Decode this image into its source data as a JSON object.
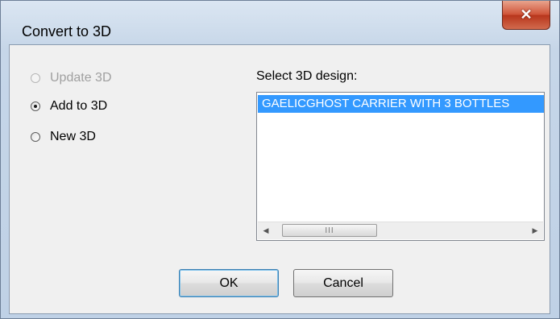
{
  "window": {
    "title": "Convert to 3D",
    "close_glyph": "✕"
  },
  "options": {
    "update": {
      "label": "Update 3D",
      "enabled": false,
      "selected": false
    },
    "add": {
      "label": "Add to 3D",
      "enabled": true,
      "selected": true
    },
    "new": {
      "label": "New 3D",
      "enabled": true,
      "selected": false
    }
  },
  "design_list": {
    "label": "Select 3D design:",
    "items": [
      "GAELICGHOST CARRIER WITH 3 BOTTLES"
    ],
    "selected_index": 0,
    "scroll_grip": "III",
    "scroll_left": "◀",
    "scroll_right": "▶"
  },
  "buttons": {
    "ok": "OK",
    "cancel": "Cancel"
  },
  "colors": {
    "selection": "#3399ff",
    "close_button": "#c9462c"
  }
}
